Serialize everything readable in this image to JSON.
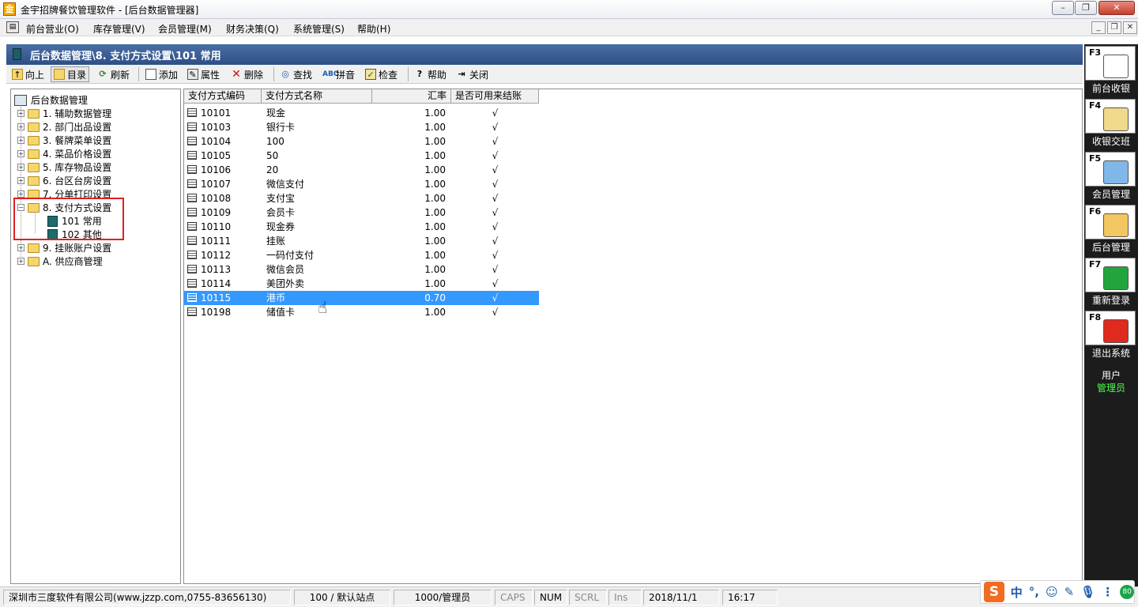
{
  "window": {
    "title": "金宇招牌餐饮管理软件 - [后台数据管理器]",
    "min_label": "–",
    "max_label": "❐",
    "close_label": "✕"
  },
  "menu": {
    "items": [
      "前台营业(O)",
      "库存管理(V)",
      "会员管理(M)",
      "财务决策(Q)",
      "系统管理(S)",
      "帮助(H)"
    ]
  },
  "path": {
    "text": "后台数据管理\\8. 支付方式设置\\101 常用"
  },
  "toolbar": {
    "up": "向上",
    "catalog": "目录",
    "refresh": "刷新",
    "add": "添加",
    "props": "属性",
    "delete": "删除",
    "find": "查找",
    "pinyin": "拼音",
    "check": "检查",
    "help": "帮助",
    "close": "关闭"
  },
  "tree": {
    "root": "后台数据管理",
    "nodes": [
      "1. 辅助数据管理",
      "2. 部门出品设置",
      "3. 餐牌菜单设置",
      "4. 菜品价格设置",
      "5. 库存物品设置",
      "6. 台区台房设置",
      "7. 分单打印设置",
      "8. 支付方式设置",
      "9. 挂账账户设置",
      "A. 供应商管理"
    ],
    "children": [
      "101 常用",
      "102 其他"
    ]
  },
  "grid": {
    "headers": [
      "支付方式编码",
      "支付方式名称",
      "汇率",
      "是否可用来结账"
    ],
    "rows": [
      {
        "code": "10101",
        "name": "现金",
        "rate": "1.00",
        "usable": "√"
      },
      {
        "code": "10103",
        "name": "银行卡",
        "rate": "1.00",
        "usable": "√"
      },
      {
        "code": "10104",
        "name": "100",
        "rate": "1.00",
        "usable": "√"
      },
      {
        "code": "10105",
        "name": "50",
        "rate": "1.00",
        "usable": "√"
      },
      {
        "code": "10106",
        "name": "20",
        "rate": "1.00",
        "usable": "√"
      },
      {
        "code": "10107",
        "name": "微信支付",
        "rate": "1.00",
        "usable": "√"
      },
      {
        "code": "10108",
        "name": "支付宝",
        "rate": "1.00",
        "usable": "√"
      },
      {
        "code": "10109",
        "name": "会员卡",
        "rate": "1.00",
        "usable": "√"
      },
      {
        "code": "10110",
        "name": "现金券",
        "rate": "1.00",
        "usable": "√"
      },
      {
        "code": "10111",
        "name": "挂账",
        "rate": "1.00",
        "usable": "√"
      },
      {
        "code": "10112",
        "name": "一码付支付",
        "rate": "1.00",
        "usable": "√"
      },
      {
        "code": "10113",
        "name": "微信会员",
        "rate": "1.00",
        "usable": "√"
      },
      {
        "code": "10114",
        "name": "美团外卖",
        "rate": "1.00",
        "usable": "√"
      },
      {
        "code": "10115",
        "name": "港币",
        "rate": "0.70",
        "usable": "√"
      },
      {
        "code": "10198",
        "name": "储值卡",
        "rate": "1.00",
        "usable": "√"
      }
    ],
    "selected_code": "10115"
  },
  "sidebar": {
    "buttons": [
      {
        "key": "F3",
        "label": "前台收银",
        "icon": "cashier-icon",
        "color": "#ffffff"
      },
      {
        "key": "F4",
        "label": "收银交班",
        "icon": "clipboard-icon",
        "color": "#f0d98a"
      },
      {
        "key": "F5",
        "label": "会员管理",
        "icon": "members-icon",
        "color": "#7fb8e8"
      },
      {
        "key": "F6",
        "label": "后台管理",
        "icon": "tools-icon",
        "color": "#f2c660"
      },
      {
        "key": "F7",
        "label": "重新登录",
        "icon": "hourglass-icon",
        "color": "#21a53c"
      },
      {
        "key": "F8",
        "label": "退出系统",
        "icon": "power-icon",
        "color": "#e02a1d"
      }
    ],
    "user_title": "用户",
    "user_name": "管理员"
  },
  "status": {
    "company": "深圳市三度软件有限公司(www.jzzp.com,0755-83656130)",
    "station": "100 / 默认站点",
    "user": "1000/管理员",
    "caps": "CAPS",
    "num": "NUM",
    "scrl": "SCRL",
    "ins": "Ins",
    "date": "2018/11/1",
    "time": "16:17"
  },
  "ime": {
    "logo": "S",
    "lang": "中",
    "badge": "80"
  }
}
